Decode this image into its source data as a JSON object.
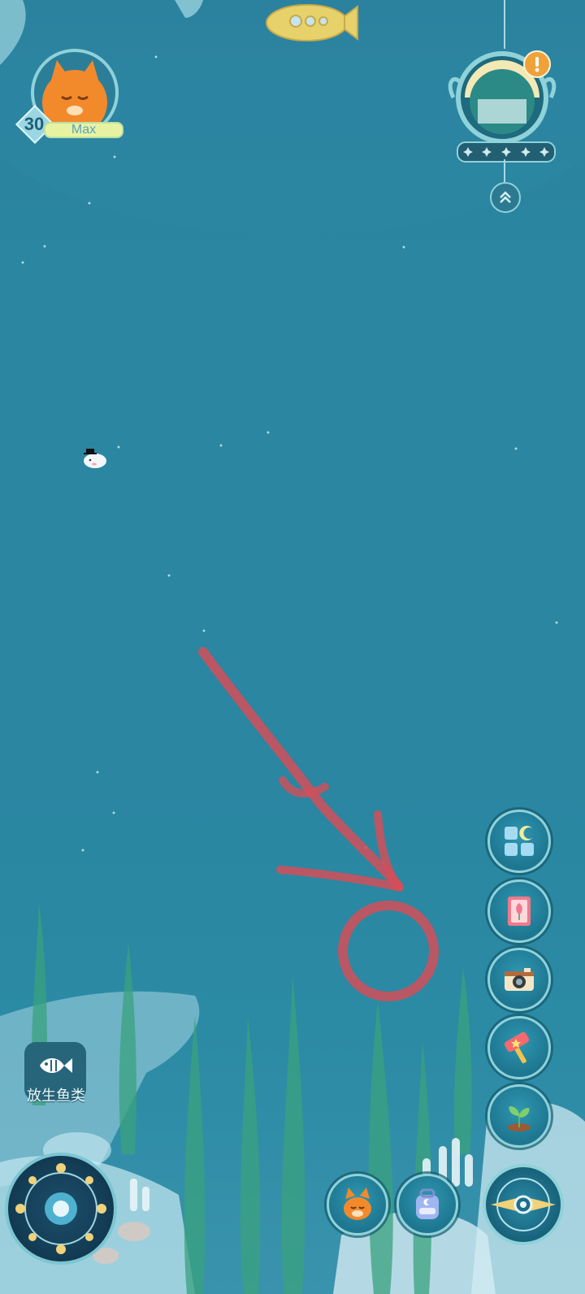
{
  "player": {
    "level": "30",
    "level_label": "Max"
  },
  "left_actions": {
    "release_fish_label": "放生鱼类"
  },
  "icons": {
    "avatar": "cat-avatar-icon",
    "alert": "exclamation-icon",
    "expand": "double-chevron-up-icon",
    "submarine": "submarine-icon",
    "fish": "fish-icon",
    "seal": "seal-with-hat-icon",
    "menu": [
      "grid-moon-icon",
      "book-icon",
      "camera-icon",
      "hammer-icon",
      "sprout-icon"
    ],
    "bottom": [
      "moon-compass-icon",
      "fox-icon",
      "backpack-icon",
      "eye-compass-icon"
    ]
  },
  "colors": {
    "water": "#2a86a1",
    "accent": "#8fd2d9",
    "annotation": "#d24f59",
    "level_bar": "#e8f3a1"
  }
}
